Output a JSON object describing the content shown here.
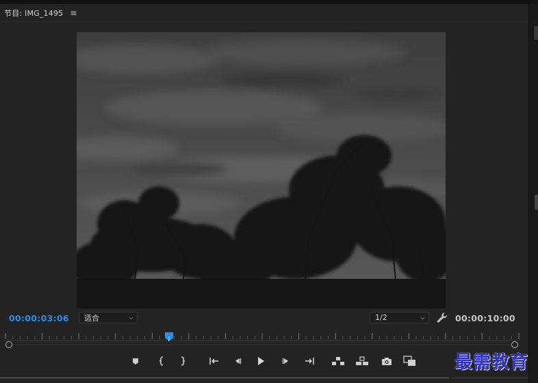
{
  "panel": {
    "title": "节目: IMG_1495",
    "menu_icon": "hamburger-menu-icon"
  },
  "timecode": {
    "current": "00:00:03:06",
    "total": "00:00:10:00"
  },
  "zoom_select": {
    "value": "适合"
  },
  "resolution_select": {
    "value": "1/2"
  },
  "playhead": {
    "position_fraction": 0.32
  },
  "controls": [
    {
      "name": "add-marker-button",
      "icon": "marker-icon"
    },
    {
      "name": "mark-in-button",
      "icon": "mark-in-icon"
    },
    {
      "name": "mark-out-button",
      "icon": "mark-out-icon"
    },
    {
      "name": "go-to-in-button",
      "icon": "go-to-in-icon"
    },
    {
      "name": "step-back-button",
      "icon": "step-back-icon"
    },
    {
      "name": "play-button",
      "icon": "play-icon"
    },
    {
      "name": "step-forward-button",
      "icon": "step-forward-icon"
    },
    {
      "name": "go-to-out-button",
      "icon": "go-to-out-icon"
    },
    {
      "name": "lift-button",
      "icon": "lift-icon"
    },
    {
      "name": "extract-button",
      "icon": "extract-icon"
    },
    {
      "name": "export-frame-button",
      "icon": "camera-icon"
    },
    {
      "name": "comparison-view-button",
      "icon": "comparison-icon"
    }
  ],
  "watermark": {
    "text": "最需教育"
  },
  "colors": {
    "accent": "#2d8ceb",
    "panel_bg": "#232323",
    "watermark": "#2c2ec8"
  }
}
